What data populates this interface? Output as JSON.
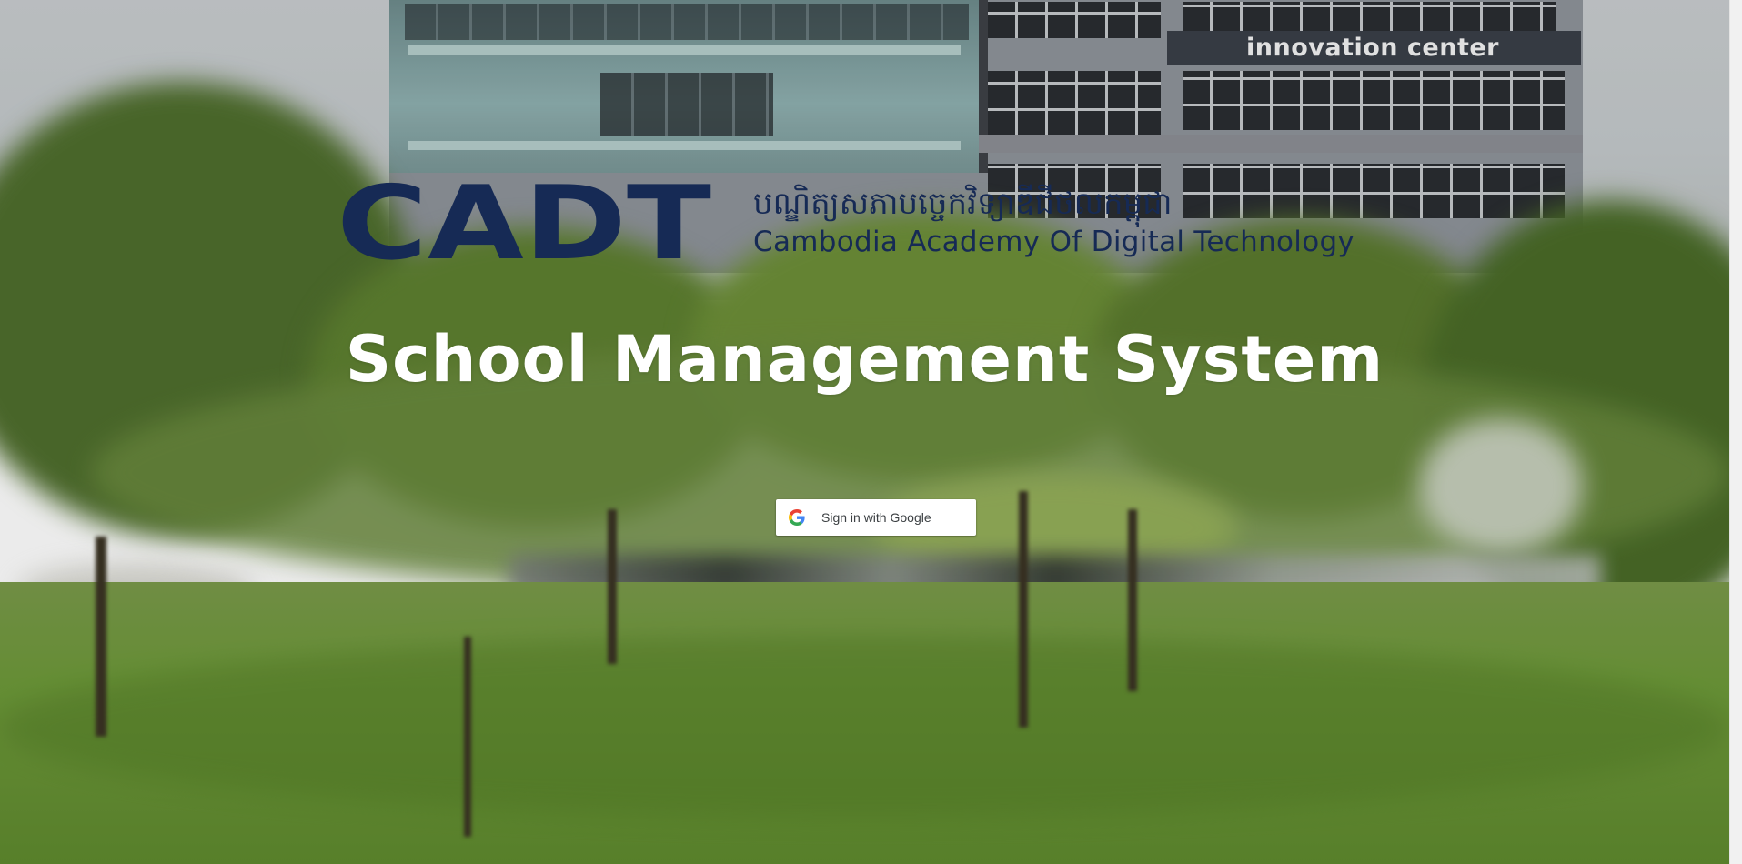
{
  "background": {
    "building_sign": "innovation center"
  },
  "logo": {
    "mark_text": "CADT",
    "khmer_name": "បណ្ឌិត្យសភាបច្ចេកវិទ្យាឌីជីថលកម្ពុជា",
    "english_name": "Cambodia Academy Of Digital Technology",
    "color": "#162a55"
  },
  "page": {
    "title": "School Management System"
  },
  "signin": {
    "label": "Sign in with Google",
    "icon": "google-g-icon"
  }
}
